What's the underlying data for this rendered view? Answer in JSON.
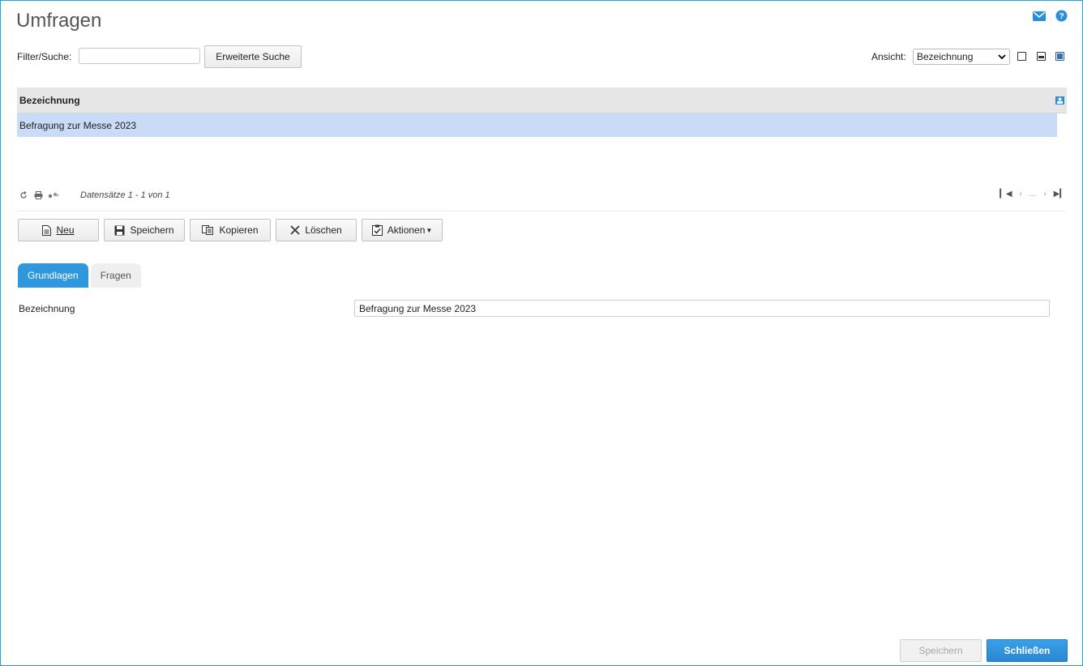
{
  "page": {
    "title": "Umfragen"
  },
  "top_icons": {
    "mail": "mail-icon",
    "help": "help-icon"
  },
  "filter": {
    "label": "Filter/Suche:",
    "value": "",
    "advanced_button": "Erweiterte Suche"
  },
  "view": {
    "label": "Ansicht:",
    "selected": "Bezeichnung"
  },
  "grid": {
    "column_header": "Bezeichnung",
    "rows": [
      {
        "bezeichnung": "Befragung zur Messe 2023"
      }
    ]
  },
  "pager": {
    "info": "Datensätze 1 - 1 von 1",
    "ellipsis": "..."
  },
  "toolbar": {
    "new": "Neu",
    "save": "Speichern",
    "copy": "Kopieren",
    "delete": "Löschen",
    "actions": "Aktionen"
  },
  "tabs": [
    {
      "label": "Grundlagen",
      "active": true
    },
    {
      "label": "Fragen",
      "active": false
    }
  ],
  "form": {
    "bezeichnung_label": "Bezeichnung",
    "bezeichnung_value": "Befragung zur Messe 2023"
  },
  "footer": {
    "save": "Speichern",
    "close": "Schließen"
  },
  "colors": {
    "accent": "#2f97dd",
    "selected_row": "#c9dbf7",
    "frame": "#2aa0d8"
  }
}
